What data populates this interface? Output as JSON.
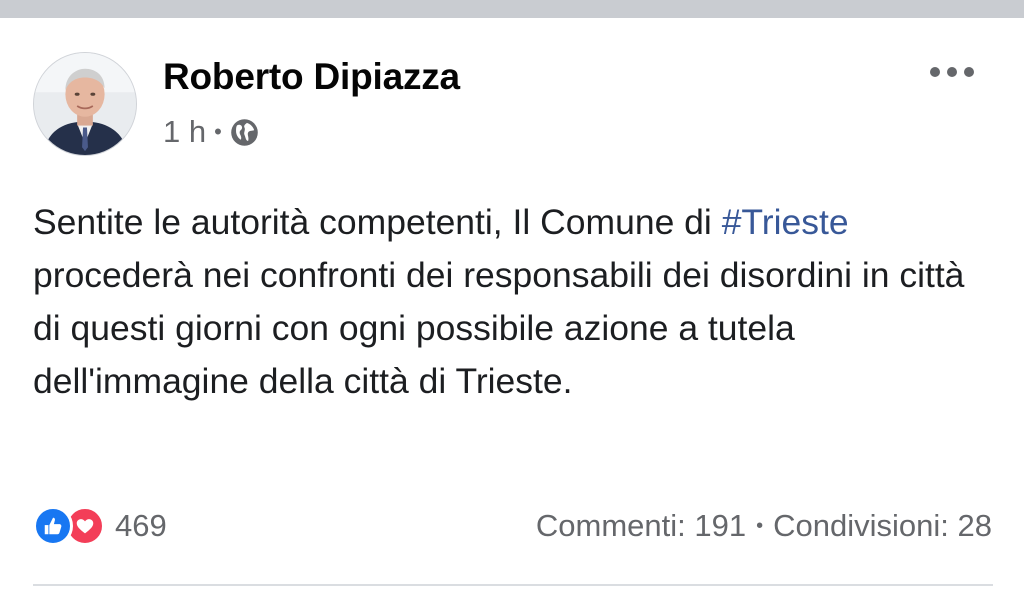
{
  "post": {
    "author": "Roberto Dipiazza",
    "time": "1 h",
    "separator": "•",
    "privacy_icon": "globe-icon",
    "menu_icon": "more-options-icon",
    "message_part1": "Sentite le autorità competenti, Il Comune di ",
    "hashtag": "#Trieste",
    "message_part2": " procederà nei confronti dei responsabili dei disordini in città di questi giorni con ogni possibile azione a tutela dell'immagine della città di Trieste."
  },
  "footer": {
    "reaction_icons": [
      "like-icon",
      "love-icon"
    ],
    "reaction_count": "469",
    "comments": "Commenti: 191",
    "separator": "•",
    "shares": "Condivisioni: 28"
  },
  "colors": {
    "link": "#385898",
    "like": "#1877f2",
    "love": "#f33e58",
    "secondary_text": "#65676b"
  }
}
